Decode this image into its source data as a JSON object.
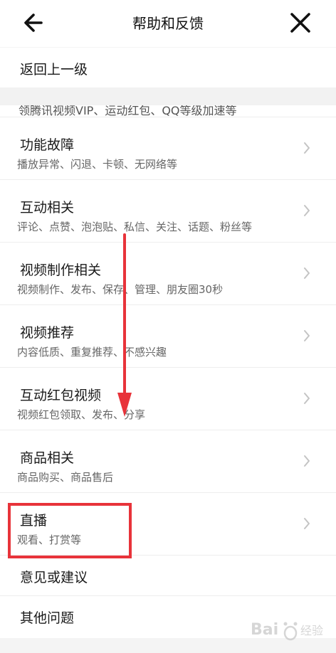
{
  "header": {
    "title": "帮助和反馈",
    "back_icon": "arrow-left-icon",
    "close_icon": "close-icon"
  },
  "top_row": {
    "label": "返回上一级"
  },
  "cut_row": {
    "text": "领腾讯视频VIP、运动红包、QQ等级加速等"
  },
  "items": [
    {
      "title": "功能故障",
      "subtitle": "播放异常、闪退、卡顿、无网络等"
    },
    {
      "title": "互动相关",
      "subtitle": "评论、点赞、泡泡贴、私信、关注、话题、粉丝等"
    },
    {
      "title": "视频制作相关",
      "subtitle": "视频制作、发布、保存、管理、朋友圈30秒"
    },
    {
      "title": "视频推荐",
      "subtitle": "内容低质、重复推荐、不感兴趣"
    },
    {
      "title": "互动红包视频",
      "subtitle": "视频红包领取、发布、分享"
    },
    {
      "title": "商品相关",
      "subtitle": "商品购买、商品售后"
    },
    {
      "title": "直播",
      "subtitle": "观看、打赏等"
    }
  ],
  "bottom_rows": [
    {
      "label": "意见或建议"
    },
    {
      "label": "其他问题"
    }
  ],
  "watermark": {
    "brand": "Bai",
    "sub": "经验"
  },
  "colors": {
    "annotation_red": "#e8333a",
    "chevron": "#c4c4c4"
  }
}
